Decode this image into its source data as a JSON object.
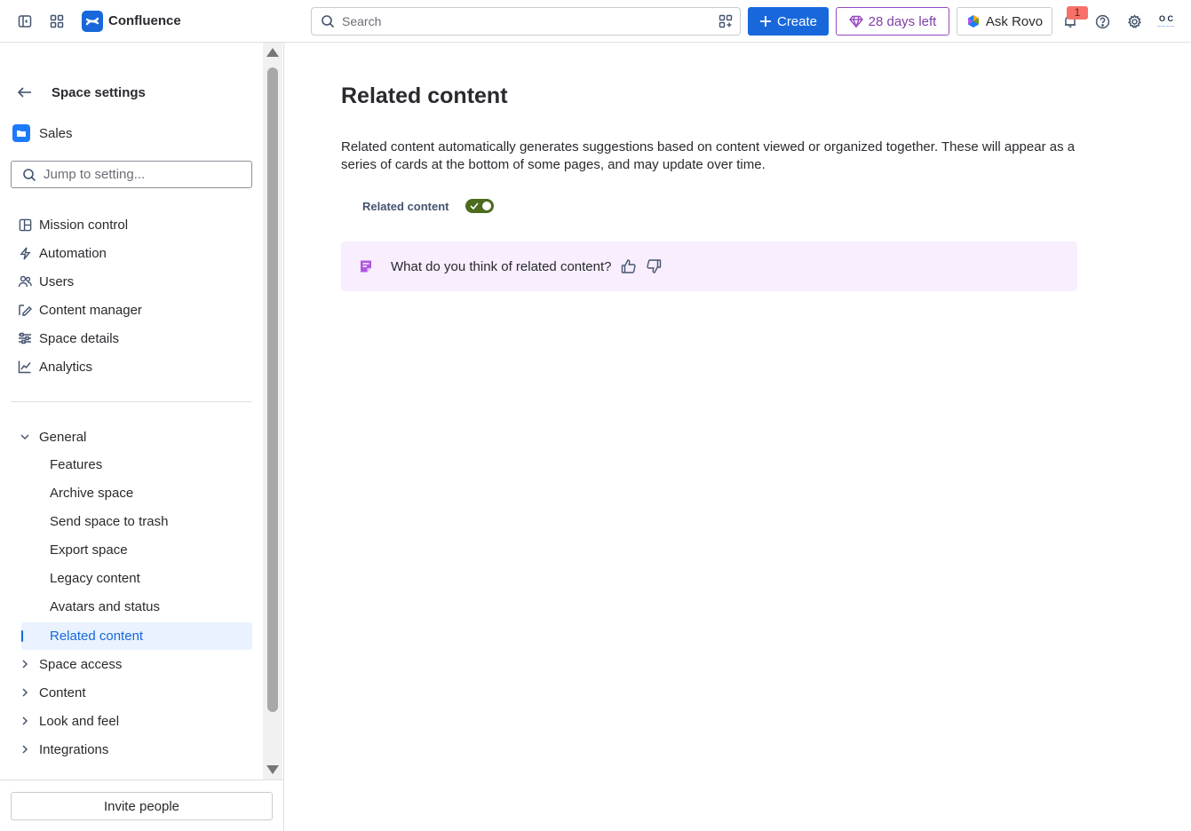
{
  "topbar": {
    "brand": "Confluence",
    "search_placeholder": "Search",
    "create_label": "Create",
    "trial_label": "28 days left",
    "rovo_label": "Ask Rovo",
    "notification_count": "1",
    "avatar_initials": "O C"
  },
  "sidebar": {
    "back_label": "Space settings",
    "space_name": "Sales",
    "jump_placeholder": "Jump to setting...",
    "nav": [
      {
        "label": "Mission control",
        "icon": "layout-icon"
      },
      {
        "label": "Automation",
        "icon": "lightning-icon"
      },
      {
        "label": "Users",
        "icon": "people-icon"
      },
      {
        "label": "Content manager",
        "icon": "edit-icon"
      },
      {
        "label": "Space details",
        "icon": "sliders-icon"
      },
      {
        "label": "Analytics",
        "icon": "chart-icon"
      }
    ],
    "general_label": "General",
    "general_items": [
      "Features",
      "Archive space",
      "Send space to trash",
      "Export space",
      "Legacy content",
      "Avatars and status"
    ],
    "active_item": "Related content",
    "collapsed_groups": [
      "Space access",
      "Content",
      "Look and feel",
      "Integrations"
    ],
    "invite_label": "Invite people"
  },
  "main": {
    "title": "Related content",
    "description": "Related content automatically generates suggestions based on content viewed or organized together. These will appear as a series of cards at the bottom of some pages, and may update over time.",
    "toggle_label": "Related content",
    "toggle_on": true,
    "feedback_question": "What do you think of related content?"
  },
  "colors": {
    "accent": "#1868db",
    "trial": "#964ac0",
    "toggle_on": "#4c6b1f",
    "feedback_bg": "#f8eefe",
    "active_nav_bg": "#e9f2fe"
  }
}
